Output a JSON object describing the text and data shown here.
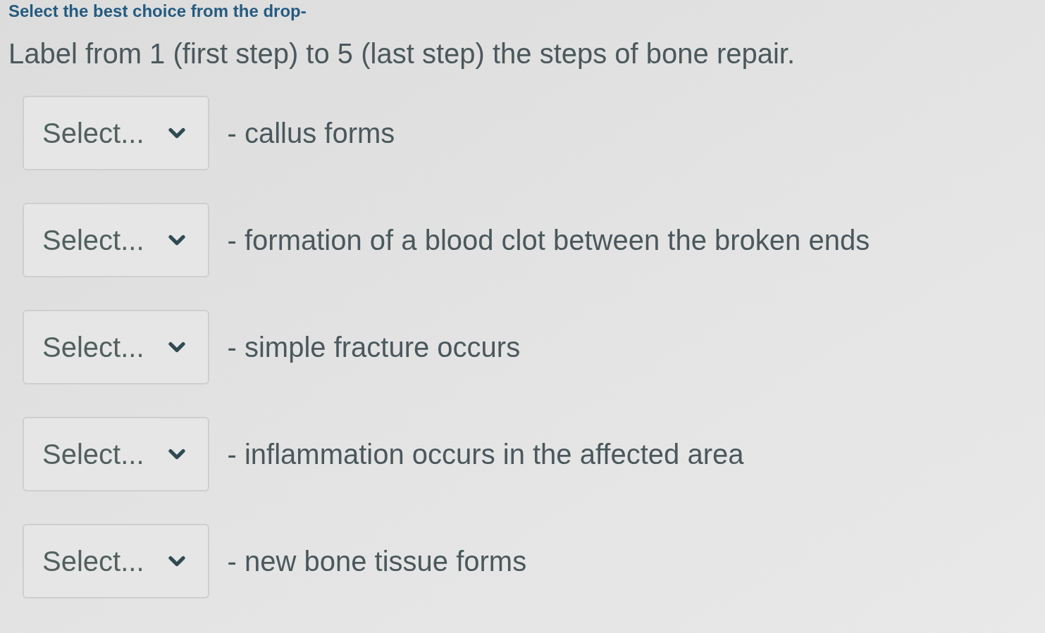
{
  "instructions": {
    "heading": "Select the best choice from the drop-",
    "prompt": "Label from 1 (first step) to 5 (last step) the steps of bone repair."
  },
  "items": [
    {
      "dropdown": {
        "placeholder": "Select..."
      },
      "text": "- callus forms"
    },
    {
      "dropdown": {
        "placeholder": "Select..."
      },
      "text": "- formation of a blood clot between the broken ends"
    },
    {
      "dropdown": {
        "placeholder": "Select..."
      },
      "text": "- simple fracture occurs"
    },
    {
      "dropdown": {
        "placeholder": "Select..."
      },
      "text": "- inflammation occurs in the affected area"
    },
    {
      "dropdown": {
        "placeholder": "Select..."
      },
      "text": "- new bone tissue forms"
    }
  ]
}
